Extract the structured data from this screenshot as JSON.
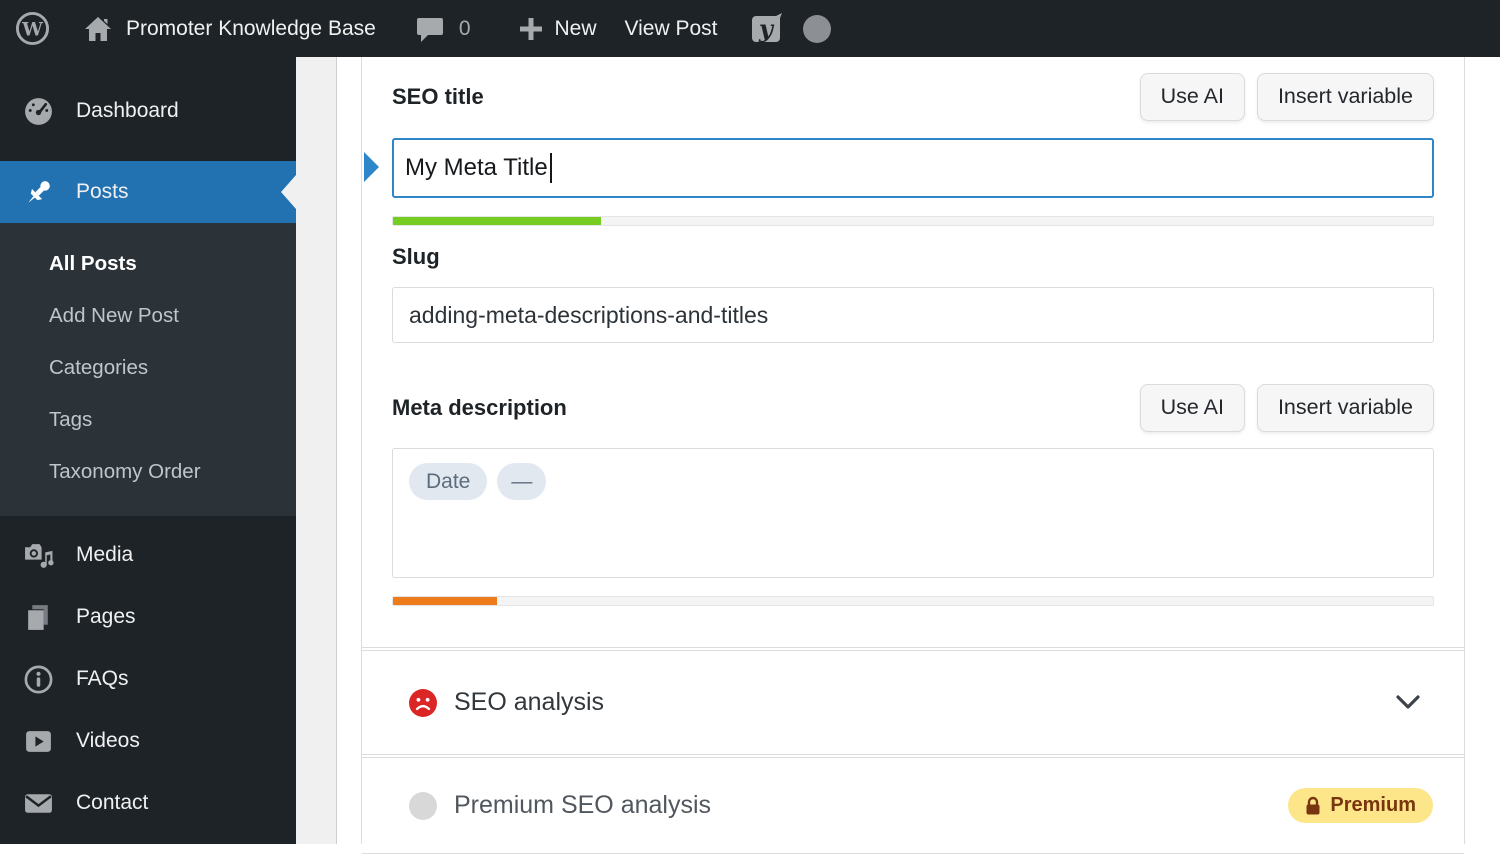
{
  "admin_bar": {
    "site_name": "Promoter Knowledge Base",
    "comment_count": "0",
    "new_label": "New",
    "view_post_label": "View Post"
  },
  "sidebar": {
    "active_color": "#2271b1",
    "items": [
      {
        "label": "Dashboard",
        "icon": "gauge-icon"
      },
      {
        "label": "Posts",
        "icon": "pushpin-icon",
        "active": true
      },
      {
        "label": "Media",
        "icon": "media-icon"
      },
      {
        "label": "Pages",
        "icon": "pages-icon"
      },
      {
        "label": "FAQs",
        "icon": "info-icon"
      },
      {
        "label": "Videos",
        "icon": "video-icon"
      },
      {
        "label": "Contact",
        "icon": "envelope-icon"
      }
    ],
    "posts_submenu": [
      "All Posts",
      "Add New Post",
      "Categories",
      "Tags",
      "Taxonomy Order"
    ],
    "current_submenu_item": "All Posts"
  },
  "editor": {
    "seo_title": {
      "label": "SEO title",
      "use_ai_label": "Use AI",
      "insert_variable_label": "Insert variable",
      "value": "My Meta Title",
      "progress": {
        "width": "20%",
        "color": "#77cc21"
      }
    },
    "slug": {
      "label": "Slug",
      "value": "adding-meta-descriptions-and-titles"
    },
    "meta_description": {
      "label": "Meta description",
      "use_ai_label": "Use AI",
      "insert_variable_label": "Insert variable",
      "tags": [
        "Date",
        "—"
      ],
      "progress": {
        "width": "10%",
        "color": "#ee7c1b"
      }
    },
    "seo_analysis": {
      "label": "SEO analysis",
      "status": "bad",
      "status_color": "#dc2626"
    },
    "premium_seo_analysis": {
      "label": "Premium SEO analysis",
      "badge_label": "Premium",
      "badge_bg": "#fde68a",
      "badge_text_color": "#78350f"
    }
  }
}
